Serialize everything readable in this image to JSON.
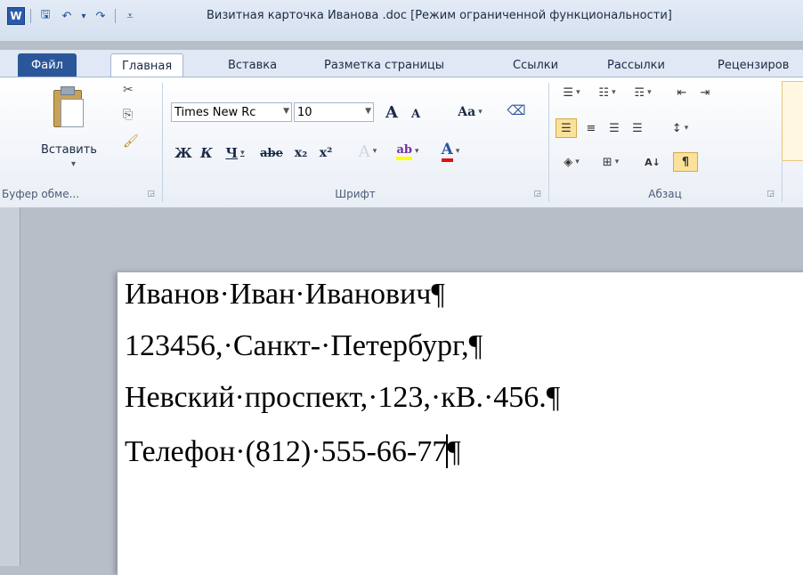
{
  "window": {
    "title": "Визитная карточка Иванова .doc [Режим ограниченной функциональности]",
    "app_icon": "W",
    "qat_icons": [
      "save-icon",
      "undo-icon",
      "redo-icon",
      "customize-icon"
    ],
    "qat_glyphs": {
      "save": "🖫",
      "undo": "↶",
      "undo_dd": "▾",
      "redo": "↷",
      "customize": "⩡"
    }
  },
  "ribbon_tabs": {
    "file": "Файл",
    "tabs": [
      "Главная",
      "Вставка",
      "Разметка страницы",
      "Ссылки",
      "Рассылки",
      "Рецензиров"
    ]
  },
  "clipboard": {
    "paste_label": "Вставить",
    "paste_dd": "▾",
    "group_label": "Буфер обме...",
    "cut_glyph": "✂",
    "copy_glyph": "⎘",
    "painter_glyph": "🖌"
  },
  "font": {
    "font_name": "Times New Rc",
    "font_size": "10",
    "grow": "A",
    "shrink": "A",
    "case": "Aa",
    "clear_glyph": "⌫",
    "bold": "Ж",
    "italic": "К",
    "underline": "Ч",
    "strike": "abe",
    "subscript": "x₂",
    "superscript": "x²",
    "effects": "A",
    "highlight": "ab",
    "font_color": "A",
    "group_label": "Шрифт"
  },
  "paragraph": {
    "bullets": "☰",
    "numbering": "☷",
    "multilevel": "☶",
    "decrease_indent": "⇤",
    "increase_indent": "⇥",
    "align_left": "☰",
    "align_center": "≡",
    "align_right": "☰",
    "justify": "☰",
    "line_spacing": "↕",
    "shading": "◈",
    "borders": "⊞",
    "sort": "A↓",
    "show_marks": "¶",
    "group_label": "Абзац"
  },
  "launcher_glyph": "◲",
  "document": {
    "lines": [
      "Иванов·Иван·Иванович",
      "123456,·Санкт-·Петербург,",
      "Невский·проспект,·123,·кВ.·456.",
      "Телефон·(812)·555-66-77"
    ],
    "pilcrow": "¶"
  },
  "colors": {
    "file_tab": "#2b579a",
    "highlight_yellow": "#ffff00",
    "font_red": "#e01010",
    "active_toggle": "#fbe29b"
  }
}
